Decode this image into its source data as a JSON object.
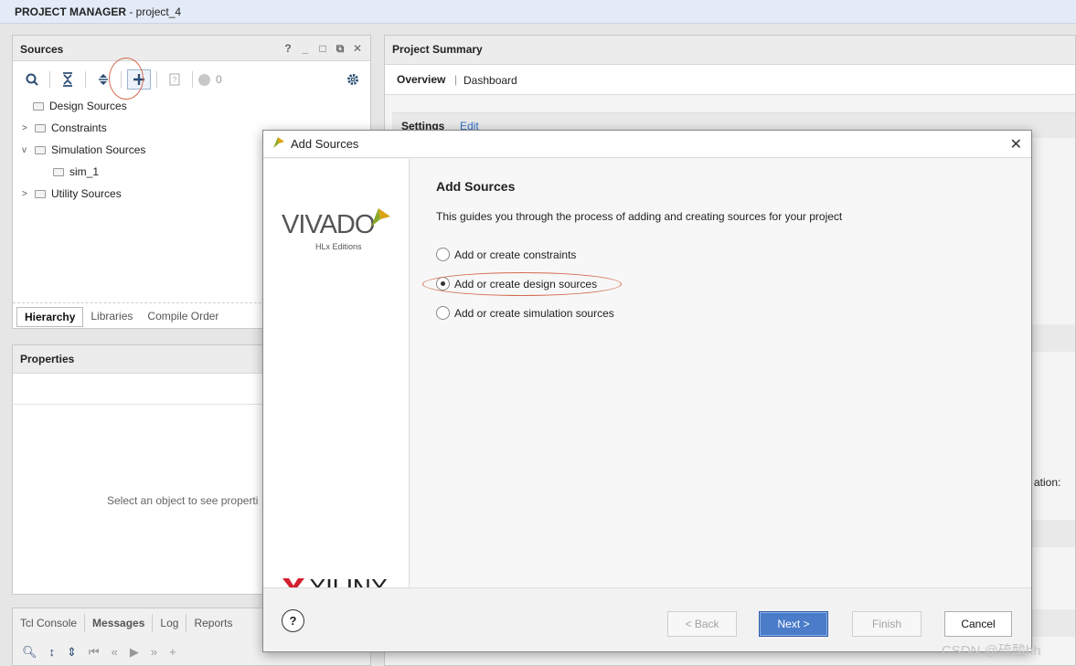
{
  "titlebar": {
    "app": "PROJECT MANAGER",
    "project": " - project_4"
  },
  "sources": {
    "title": "Sources",
    "win_buttons": [
      "?",
      "_",
      "□",
      "⧉",
      "✕"
    ],
    "badge_count": "0",
    "tree": [
      {
        "label": "Design Sources",
        "expandable": false
      },
      {
        "label": "Constraints",
        "expandable": true
      },
      {
        "label": "Simulation Sources",
        "expandable": true,
        "expanded": true
      },
      {
        "label": "sim_1",
        "child": true
      },
      {
        "label": "Utility Sources",
        "expandable": true
      }
    ],
    "tabs": [
      "Hierarchy",
      "Libraries",
      "Compile Order"
    ]
  },
  "properties": {
    "title": "Properties",
    "placeholder": "Select an object to see properti"
  },
  "bottom": {
    "tabs": [
      "Tcl Console",
      "Messages",
      "Log",
      "Reports"
    ]
  },
  "summary": {
    "title": "Project Summary",
    "tabs": [
      "Overview",
      "Dashboard"
    ],
    "settings_label": "Settings",
    "edit_link": "Edit",
    "partial_text": "ation:"
  },
  "dialog": {
    "title": "Add Sources",
    "close": "✕",
    "brand_vivado": "VIVADO",
    "brand_sub": "HLx Editions",
    "brand_xilinx": "XILINX",
    "heading": "Add Sources",
    "description": "This guides you through the process of adding and creating sources for your project",
    "options": [
      {
        "label": "Add or create constraints",
        "checked": false
      },
      {
        "label": "Add or create design sources",
        "checked": true
      },
      {
        "label": "Add or create simulation sources",
        "checked": false
      }
    ],
    "help": "?",
    "buttons": {
      "back": "< Back",
      "next": "Next >",
      "finish": "Finish",
      "cancel": "Cancel"
    }
  },
  "watermark": "CSDN @硫酸hh",
  "colors": {
    "accent": "#4a7cc9",
    "annotation": "#d46a4e",
    "link": "#2f6fc9"
  }
}
